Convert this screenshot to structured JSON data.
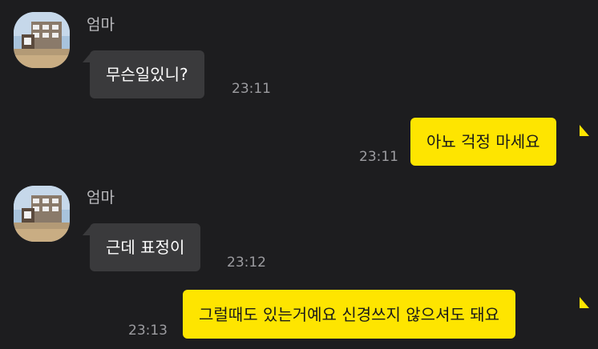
{
  "messages": [
    {
      "direction": "incoming",
      "sender": "엄마",
      "text": "무슨일있니?",
      "time": "23:11",
      "avatar_icon": "profile-photo-building"
    },
    {
      "direction": "outgoing",
      "text": "아뇨 걱정 마세요",
      "time": "23:11"
    },
    {
      "direction": "incoming",
      "sender": "엄마",
      "text": "근데 표정이",
      "time": "23:12",
      "avatar_icon": "profile-photo-building"
    },
    {
      "direction": "outgoing",
      "text": "그럴때도 있는거예요 신경쓰지 않으셔도 돼요",
      "time": "23:13"
    }
  ],
  "colors": {
    "background": "#1d1d1f",
    "incoming_bubble": "#3a3a3c",
    "outgoing_bubble": "#fee500",
    "timestamp": "#9c9ca0",
    "sender_name": "#b9b9bc"
  }
}
